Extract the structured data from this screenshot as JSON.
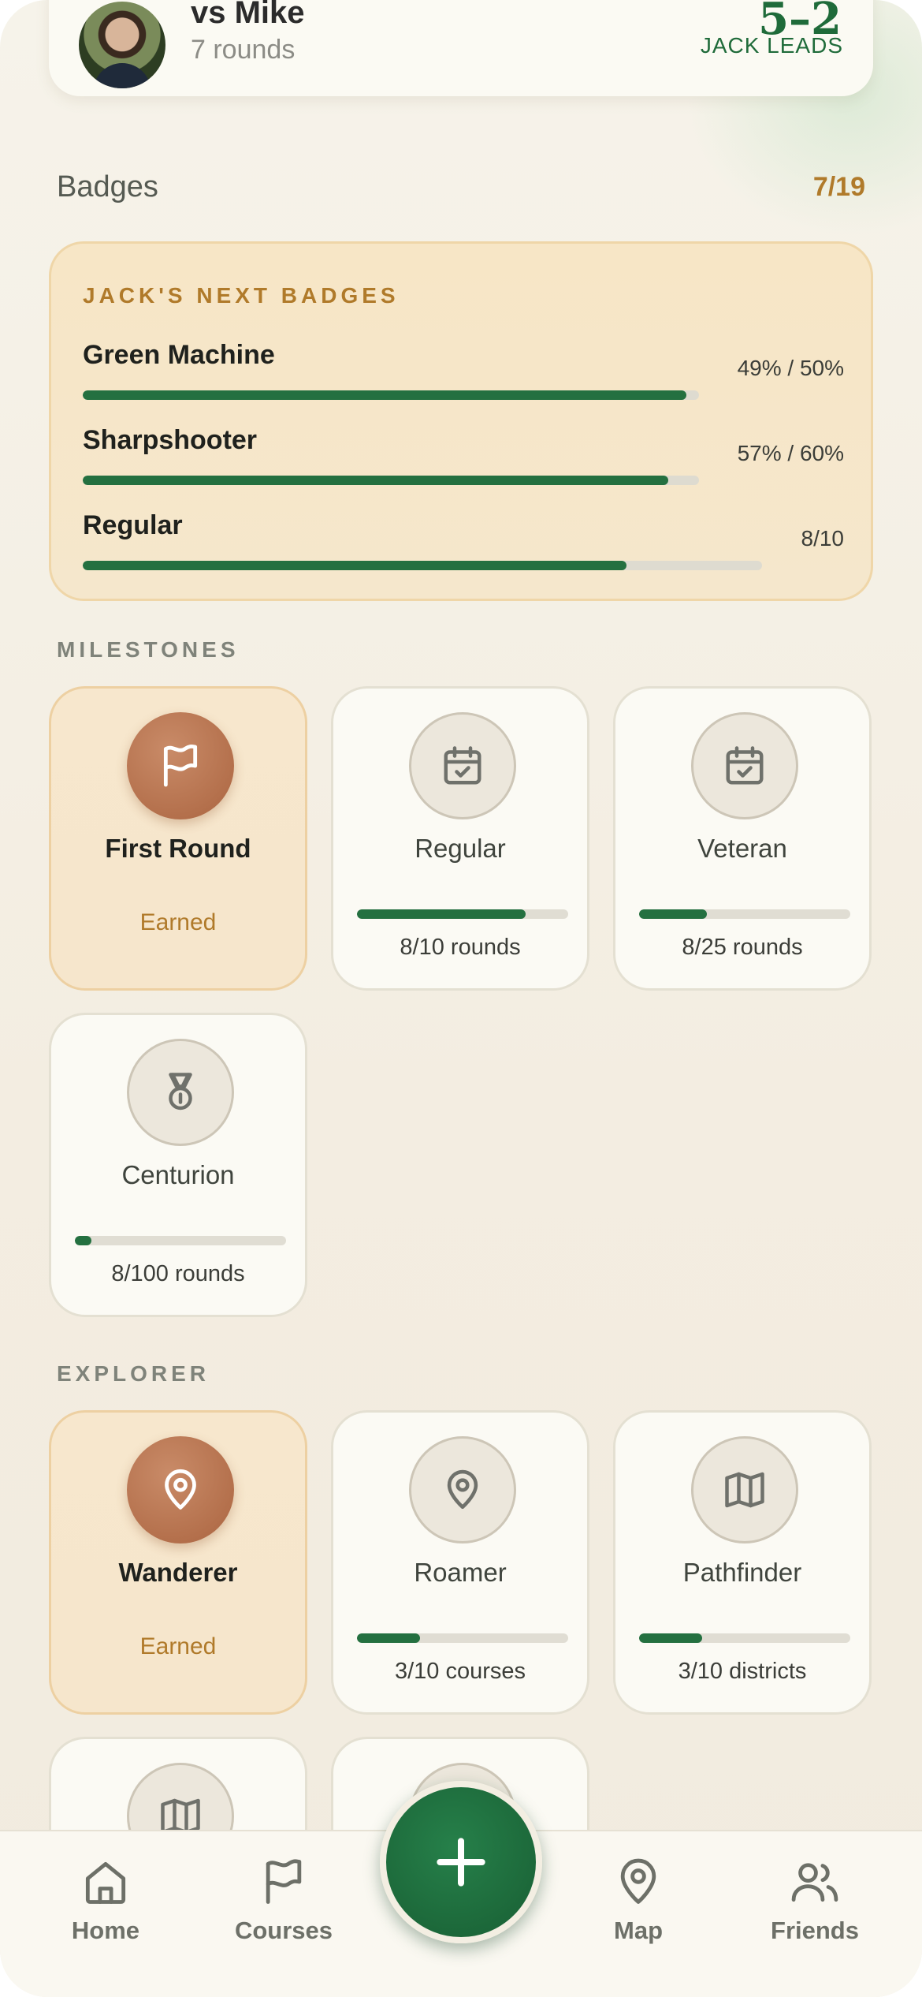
{
  "rival": {
    "name": "vs Mike",
    "rounds": "7 rounds",
    "score": "5–2",
    "status": "JACK LEADS"
  },
  "badges": {
    "title": "Badges",
    "count": "7/19"
  },
  "next_badges": {
    "title": "JACK'S NEXT BADGES",
    "items": [
      {
        "name": "Green Machine",
        "value": "49% / 50%",
        "progress": 0.98
      },
      {
        "name": "Sharpshooter",
        "value": "57% / 60%",
        "progress": 0.95
      },
      {
        "name": "Regular",
        "value": "8/10",
        "progress": 0.8
      }
    ]
  },
  "milestones": {
    "label": "MILESTONES",
    "items": [
      {
        "name": "First Round",
        "status": "Earned",
        "icon": "flag-icon",
        "earned": true
      },
      {
        "name": "Regular",
        "progress_text": "8/10 rounds",
        "progress": 0.8,
        "icon": "calendar-check-icon"
      },
      {
        "name": "Veteran",
        "progress_text": "8/25 rounds",
        "progress": 0.32,
        "icon": "calendar-check-icon"
      },
      {
        "name": "Centurion",
        "progress_text": "8/100 rounds",
        "progress": 0.08,
        "icon": "medal-icon"
      }
    ]
  },
  "explorer": {
    "label": "EXPLORER",
    "items": [
      {
        "name": "Wanderer",
        "status": "Earned",
        "icon": "map-pin-icon",
        "earned": true
      },
      {
        "name": "Roamer",
        "progress_text": "3/10 courses",
        "progress": 0.3,
        "icon": "map-pin-icon"
      },
      {
        "name": "Pathfinder",
        "progress_text": "3/10 districts",
        "progress": 0.3,
        "icon": "map-icon"
      }
    ]
  },
  "nav": {
    "items": [
      {
        "label": "Home",
        "icon": "home-icon"
      },
      {
        "label": "Courses",
        "icon": "flag-icon"
      },
      {
        "label": "Map",
        "icon": "map-pin-icon"
      },
      {
        "label": "Friends",
        "icon": "users-icon"
      }
    ],
    "fab_icon": "plus-icon"
  },
  "colors": {
    "accent_green": "#247040",
    "accent_gold": "#b07a2a",
    "earned_badge": "#b4704c"
  }
}
